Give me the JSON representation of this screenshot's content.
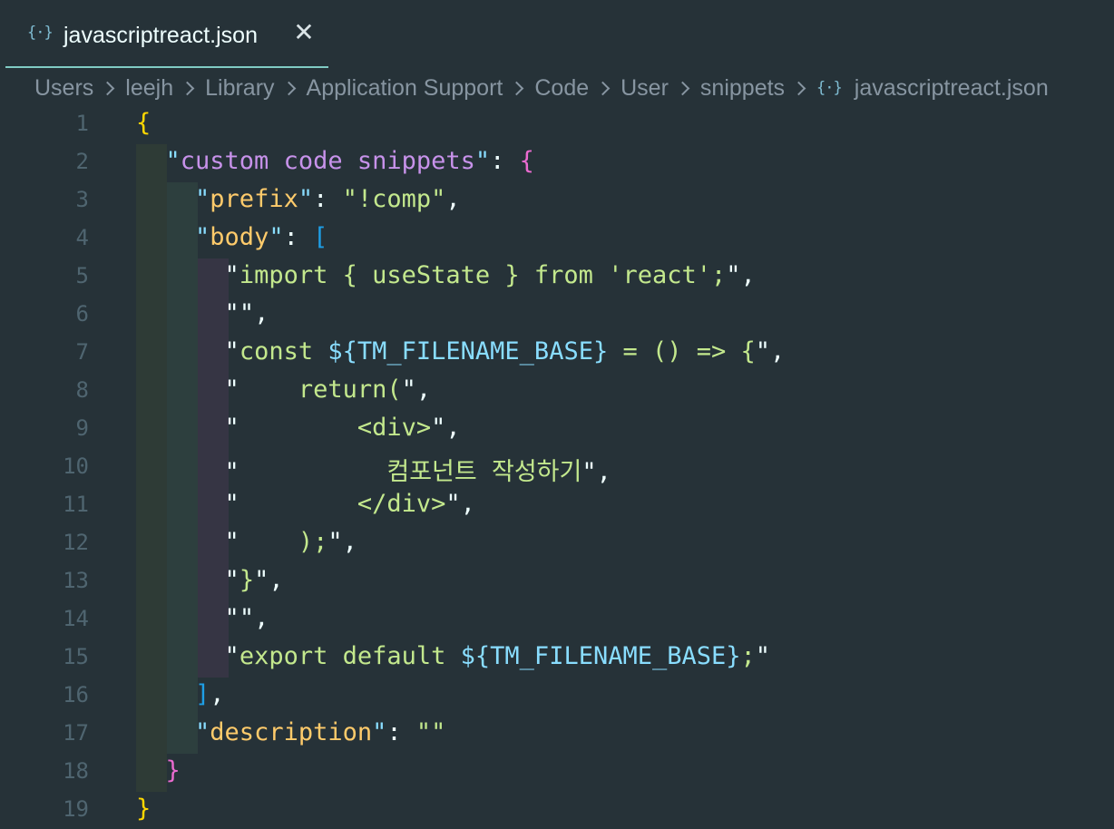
{
  "tab": {
    "icon": "{·}",
    "title": "javascriptreact.json",
    "close": "✕"
  },
  "breadcrumb": {
    "items": [
      "Users",
      "leejh",
      "Library",
      "Application Support",
      "Code",
      "User",
      "snippets"
    ],
    "file_icon": "{·}",
    "file": "javascriptreact.json"
  },
  "editor": {
    "line_numbers": [
      "1",
      "2",
      "3",
      "4",
      "5",
      "6",
      "7",
      "8",
      "9",
      "10",
      "11",
      "12",
      "13",
      "14",
      "15",
      "16",
      "17",
      "18",
      "19"
    ],
    "lines": [
      "{",
      "  \"custom code snippets\": {",
      "    \"prefix\": \"!comp\",",
      "    \"body\": [",
      "      \"import { useState } from 'react';\",",
      "      \"\",",
      "      \"const ${TM_FILENAME_BASE} = () => {\",",
      "      \"    return(\",",
      "      \"        <div>\",",
      "      \"          컴포넌트 작성하기\",",
      "      \"        </div>\",",
      "      \"    );\",",
      "      \"}\",",
      "      \"\",",
      "      \"export default ${TM_FILENAME_BASE};\"",
      "    ],",
      "    \"description\": \"\"",
      "  }",
      "}"
    ]
  },
  "colors": {
    "background": "#263238",
    "string": "#c3e88d",
    "key": "#ffcb6b",
    "brace_outer": "#ffd700",
    "brace_inner": "#ea6bd0",
    "bracket": "#1e9fe6",
    "tab_underline": "#80cbc4"
  }
}
